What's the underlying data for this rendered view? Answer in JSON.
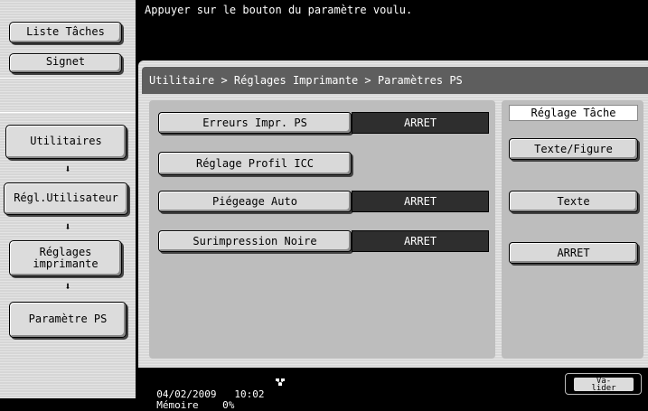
{
  "header": {
    "message": "Appuyer sur le bouton du paramètre voulu."
  },
  "sidebar": {
    "job_list_label": "Liste Tâches",
    "bookmark_label": "Signet",
    "nav": [
      "Utilitaires",
      "Régl.Utilisateur",
      "Réglages imprimante",
      "Paramètre PS"
    ],
    "arrow_glyph": "⬇"
  },
  "breadcrumb": "Utilitaire > Réglages Imprimante > Paramètres PS",
  "settings": [
    {
      "label": "Erreurs Impr. PS",
      "value": "ARRET"
    },
    {
      "label": "Réglage Profil ICC",
      "value": ""
    },
    {
      "label": "Piégeage Auto",
      "value": "ARRET"
    },
    {
      "label": "Surimpression Noire",
      "value": "ARRET"
    }
  ],
  "job_settings": {
    "title": "Réglage Tâche",
    "buttons": [
      "Texte/Figure",
      "Texte",
      "ARRET"
    ]
  },
  "footer": {
    "date": "04/02/2009",
    "time": "10:02",
    "memory_label": "Mémoire",
    "memory_value": "0%",
    "validate_label_1": "Va-",
    "validate_label_2": "lider"
  }
}
